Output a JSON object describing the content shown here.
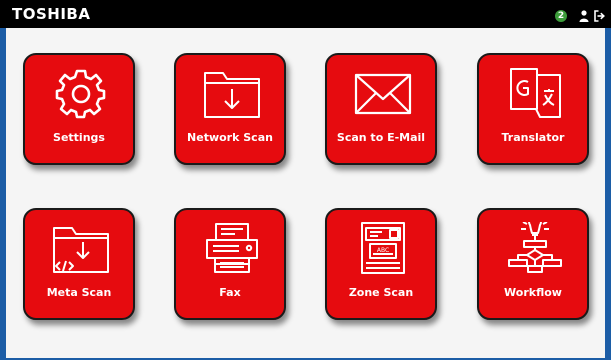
{
  "header": {
    "brand": "TOSHIBA",
    "notification_count": "2",
    "icons": [
      "user-icon",
      "logout-icon"
    ]
  },
  "colors": {
    "outer_frame": "#1c5da6",
    "topbar": "#000000",
    "tile_red": "#e60b0f",
    "badge_green": "#3c9c3a",
    "content_background": "#f5f5f5"
  },
  "tiles": [
    {
      "label": "Settings",
      "icon": "gear-icon"
    },
    {
      "label": "Network Scan",
      "icon": "folder-download-icon"
    },
    {
      "label": "Scan to E-Mail",
      "icon": "envelope-icon"
    },
    {
      "label": "Translator",
      "icon": "translate-icon"
    },
    {
      "label": "Meta Scan",
      "icon": "folder-code-download-icon"
    },
    {
      "label": "Fax",
      "icon": "fax-machine-icon"
    },
    {
      "label": "Zone Scan",
      "icon": "zone-document-icon"
    },
    {
      "label": "Workflow",
      "icon": "workflow-icon"
    }
  ]
}
